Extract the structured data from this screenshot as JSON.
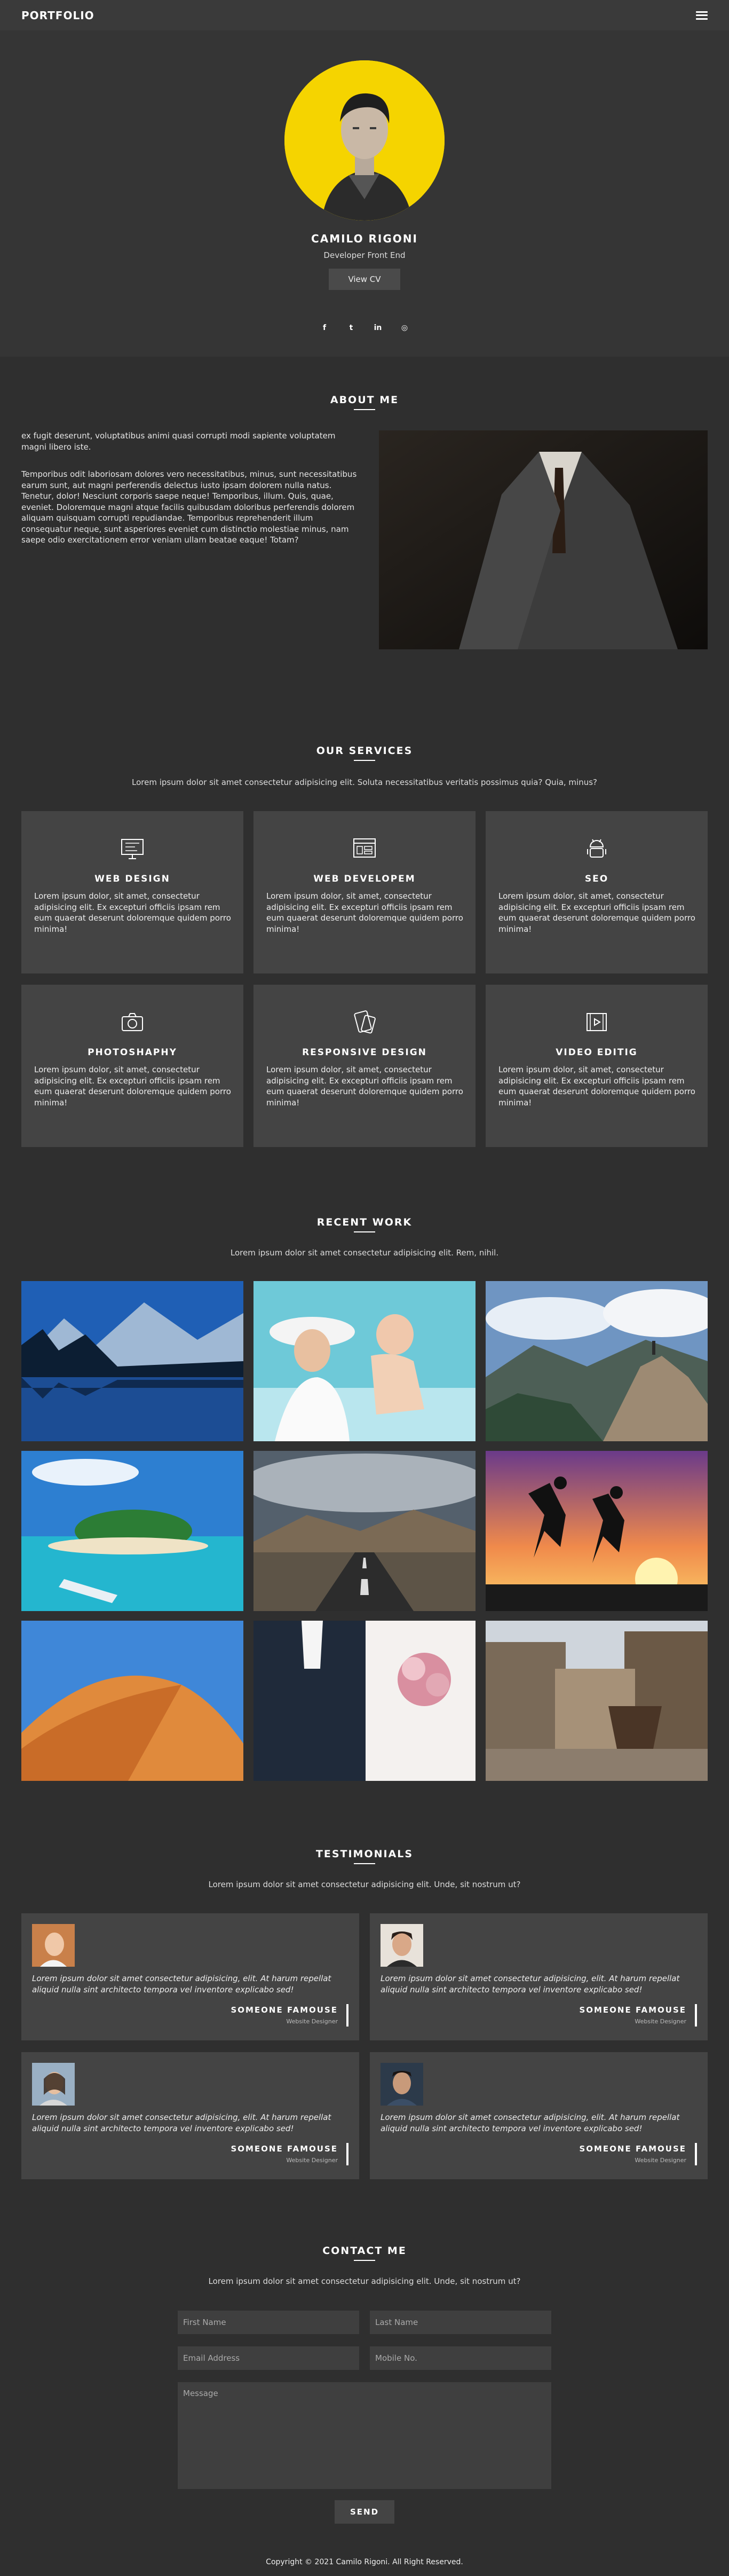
{
  "nav": {
    "brand": "PORTFOLIO",
    "menu_icon": "hamburger-icon"
  },
  "hero": {
    "name": "CAMILO RIGONI",
    "role": "Developer Front End",
    "cv_label": "View CV",
    "social": [
      {
        "icon": "facebook-icon",
        "glyph": "f"
      },
      {
        "icon": "twitter-icon",
        "glyph": "t"
      },
      {
        "icon": "linkedin-icon",
        "glyph": "in"
      },
      {
        "icon": "instagram-icon",
        "glyph": "◎"
      }
    ],
    "avatar_bg": "#f5d400"
  },
  "about": {
    "title": "ABOUT ME",
    "p1": "ex fugit deserunt, voluptatibus animi quasi corrupti modi sapiente voluptatem magni libero iste.",
    "p2": "Temporibus odit laboriosam dolores vero necessitatibus, minus, sunt necessitatibus earum sunt, aut magni perferendis delectus iusto ipsam dolorem nulla natus. Tenetur, dolor! Nesciunt corporis saepe neque! Temporibus, illum. Quis, quae, eveniet. Doloremque magni atque facilis quibusdam doloribus perferendis dolorem aliquam quisquam corrupti repudiandae. Temporibus reprehenderit illum consequatur neque, sunt asperiores eveniet cum distinctio molestiae minus, nam saepe odio exercitationem error veniam ullam beatae eaque! Totam?"
  },
  "services": {
    "title": "OUR SERVICES",
    "subtitle": "Lorem ipsum dolor sit amet consectetur adipisicing elit. Soluta necessitatibus veritatis possimus quia? Quia, minus?",
    "items": [
      {
        "title": "WEB DESIGN",
        "icon": "monitor-icon",
        "desc": "Lorem ipsum dolor, sit amet, consectetur adipisicing elit. Ex excepturi officiis ipsam rem eum quaerat deserunt doloremque quidem porro minima!"
      },
      {
        "title": "WEB DEVELOPEM",
        "icon": "browser-code-icon",
        "desc": "Lorem ipsum dolor, sit amet, consectetur adipisicing elit. Ex excepturi officiis ipsam rem eum quaerat deserunt doloremque quidem porro minima!"
      },
      {
        "title": "SEO",
        "icon": "android-icon",
        "desc": "Lorem ipsum dolor, sit amet, consectetur adipisicing elit. Ex excepturi officiis ipsam rem eum quaerat deserunt doloremque quidem porro minima!"
      },
      {
        "title": "PHOTOSHAPHY",
        "icon": "camera-icon",
        "desc": "Lorem ipsum dolor, sit amet, consectetur adipisicing elit. Ex excepturi officiis ipsam rem eum quaerat deserunt doloremque quidem porro minima!"
      },
      {
        "title": "RESPONSIVE DESIGN",
        "icon": "devices-icon",
        "desc": "Lorem ipsum dolor, sit amet, consectetur adipisicing elit. Ex excepturi officiis ipsam rem eum quaerat deserunt doloremque quidem porro minima!"
      },
      {
        "title": "VIDEO EDITIG",
        "icon": "video-icon",
        "desc": "Lorem ipsum dolor, sit amet, consectetur adipisicing elit. Ex excepturi officiis ipsam rem eum quaerat deserunt doloremque quidem porro minima!"
      }
    ]
  },
  "work": {
    "title": "RECENT WORK",
    "subtitle": "Lorem ipsum dolor sit amet consectetur adipisicing elit. Rem, nihil.",
    "photos": [
      "lake-mountains-photo",
      "mother-baby-photo",
      "hiker-cliff-photo",
      "tropical-island-photo",
      "desert-road-photo",
      "sunset-jump-photo",
      "sand-dune-photo",
      "wedding-couple-photo",
      "town-square-photo"
    ]
  },
  "testimonials": {
    "title": "TESTIMONIALS",
    "subtitle": "Lorem ipsum dolor sit amet consectetur adipisicing elit. Unde, sit nostrum ut?",
    "items": [
      {
        "quote": "Lorem ipsum dolor sit amet consectetur adipisicing, elit. At harum repellat aliquid nulla sint architecto tempora vel inventore explicabo sed!",
        "name": "SOMEONE FAMOUSE",
        "role": "Website Designer"
      },
      {
        "quote": "Lorem ipsum dolor sit amet consectetur adipisicing, elit. At harum repellat aliquid nulla sint architecto tempora vel inventore explicabo sed!",
        "name": "SOMEONE FAMOUSE",
        "role": "Website Designer"
      },
      {
        "quote": "Lorem ipsum dolor sit amet consectetur adipisicing, elit. At harum repellat aliquid nulla sint architecto tempora vel inventore explicabo sed!",
        "name": "SOMEONE FAMOUSE",
        "role": "Website Designer"
      },
      {
        "quote": "Lorem ipsum dolor sit amet consectetur adipisicing, elit. At harum repellat aliquid nulla sint architecto tempora vel inventore explicabo sed!",
        "name": "SOMEONE FAMOUSE",
        "role": "Website Designer"
      }
    ]
  },
  "contact": {
    "title": "CONTACT ME",
    "subtitle": "Lorem ipsum dolor sit amet consectetur adipisicing elit. Unde, sit nostrum ut?",
    "first_name": "First Name",
    "last_name": "Last Name",
    "email": "Email Address",
    "mobile": "Mobile No.",
    "message": "Message",
    "send": "SEND"
  },
  "footer": {
    "text": "Copyright © 2021 Camilo Rigoni. All Right Reserved."
  }
}
